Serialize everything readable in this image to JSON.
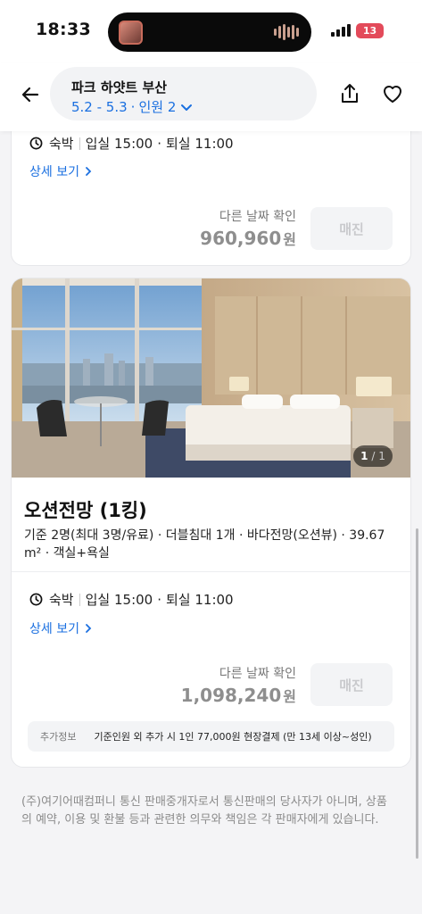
{
  "status_bar": {
    "time": "18:33",
    "battery": "13"
  },
  "header": {
    "hotel_name": "파크 하얏트 부산",
    "dates": "5.2 - 5.3",
    "separator": "·",
    "guests": "인원 2"
  },
  "room_prev": {
    "stay_type": "숙박",
    "checkin": "입실 15:00",
    "dot": "·",
    "checkout": "퇴실 11:00",
    "detail_link": "상세 보기",
    "date_check": "다른 날짜 확인",
    "price": "960,960",
    "currency": "원",
    "soldout": "매진"
  },
  "room_ocean": {
    "image_counter_current": "1",
    "image_counter_total": "/ 1",
    "title": "오션전망 (1킹)",
    "description": "기준 2명(최대 3명/유료) · 더블침대 1개 · 바다전망(오션뷰) · 39.67 m² · 객실+욕실",
    "stay_type": "숙박",
    "checkin": "입실 15:00",
    "dot": "·",
    "checkout": "퇴실 11:00",
    "detail_link": "상세 보기",
    "date_check": "다른 날짜 확인",
    "price": "1,098,240",
    "currency": "원",
    "soldout": "매진",
    "extra_label": "추가정보",
    "extra_text": "기준인원 외 추가 시 1인 77,000원 현장결제 (만 13세 이상~성인)"
  },
  "footer_note": "(주)여기어때컴퍼니 통신 판매중개자로서 통신판매의 당사자가 아니며, 상품의 예약, 이용 및 환불 등과 관련한 의무와 책임은 각 판매자에게 있습니다.",
  "colors": {
    "accent_blue": "#1a6fe0",
    "battery_red": "#e34a5a",
    "price_gray": "#8e8e8e",
    "background": "#f4f4f6"
  }
}
